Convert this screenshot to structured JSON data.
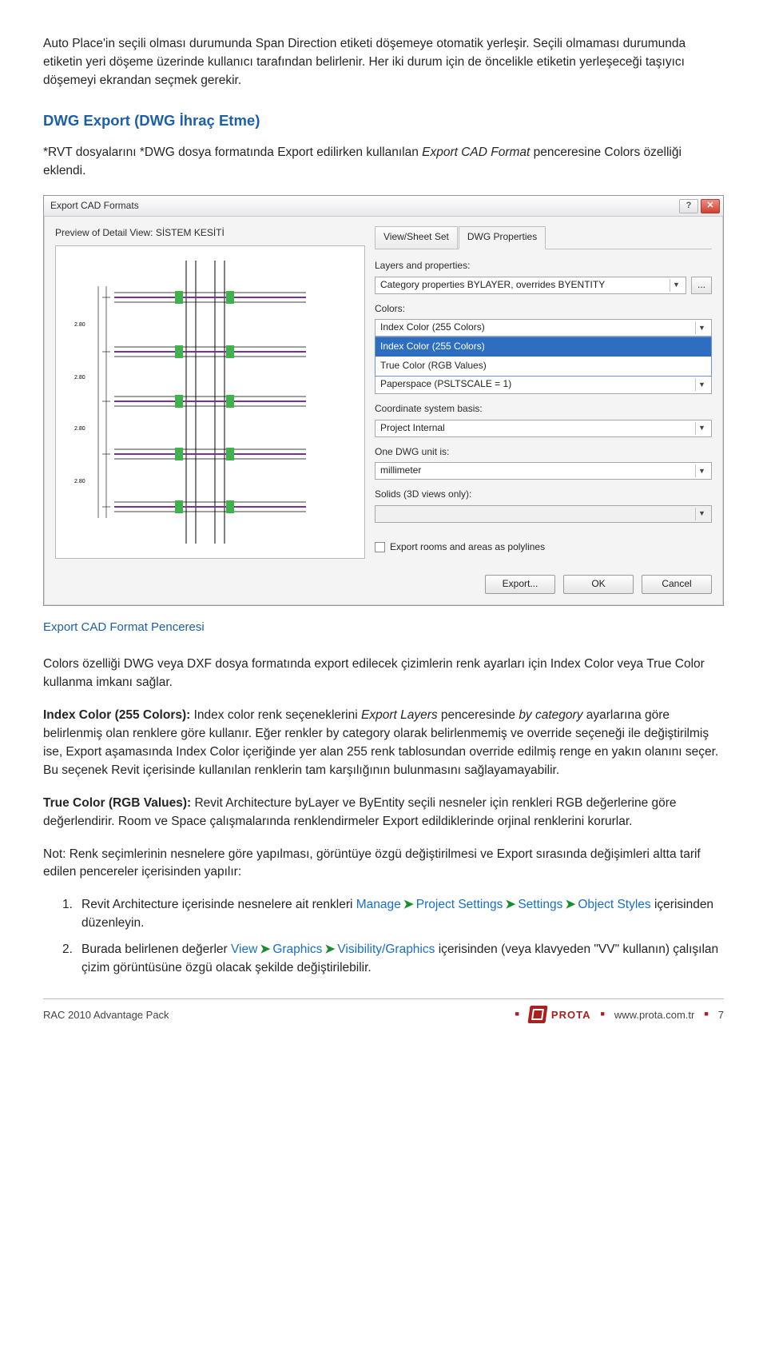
{
  "intro_para_1": "Auto Place'in seçili olması durumunda Span Direction etiketi döşemeye otomatik yerleşir. Seçili olmaması durumunda etiketin yeri döşeme üzerinde kullanıcı tarafından belirlenir. Her iki durum için de öncelikle etiketin yerleşeceği taşıyıcı döşemeyi ekrandan seçmek gerekir.",
  "heading_dwg": "DWG Export (DWG İhraç Etme)",
  "rvt_para_lead": "*RVT dosyalarını *DWG dosya formatında Export edilirken kullanılan ",
  "rvt_para_italic": "Export CAD Format",
  "rvt_para_tail": " penceresine Colors özelliği eklendi.",
  "dialog": {
    "title": "Export CAD Formats",
    "help_icon": "?",
    "close_icon": "✕",
    "preview_label": "Preview of Detail View: SİSTEM KESİTİ",
    "tabs": {
      "view": "View/Sheet Set",
      "dwg": "DWG Properties"
    },
    "fields": {
      "layers_label": "Layers and properties:",
      "layers_value": "Category properties BYLAYER, overrides BYENTITY",
      "colors_label": "Colors:",
      "colors_selected": "Index Color (255 Colors)",
      "colors_options": [
        "Index Color (255 Colors)",
        "True Color (RGB Values)"
      ],
      "linetype_label": "",
      "linetype_value": "Paperspace (PSLTSCALE = 1)",
      "coord_label": "Coordinate system basis:",
      "coord_value": "Project Internal",
      "unit_label": "One DWG unit is:",
      "unit_value": "millimeter",
      "solids_label": "Solids (3D views only):",
      "solids_value": ""
    },
    "checkbox_label": "Export rooms and areas as polylines",
    "buttons": {
      "export": "Export...",
      "ok": "OK",
      "cancel": "Cancel"
    }
  },
  "caption": "Export CAD Format Penceresi",
  "colors_para": "Colors özelliği DWG veya DXF dosya formatında export edilecek çizimlerin renk ayarları için Index Color veya True Color kullanma imkanı sağlar.",
  "index_bold": "Index Color (255 Colors): ",
  "index_seg1": "Index color renk seçeneklerini ",
  "index_italic1": "Export Layers",
  "index_seg2": " penceresinde ",
  "index_italic2": "by category",
  "index_seg3": " ayarlarına göre belirlenmiş olan renklere göre kullanır. Eğer renkler by category olarak belirlenmemiş ve override seçeneği ile değiştirilmiş ise, Export aşamasında Index Color içeriğinde yer alan 255 renk tablosundan override edilmiş renge en yakın olanını seçer. Bu seçenek Revit içerisinde kullanılan renklerin tam karşılığının bulunmasını sağlayamayabilir.",
  "true_bold": "True Color (RGB Values): ",
  "true_rest": "Revit Architecture byLayer ve ByEntity seçili nesneler için renkleri RGB değerlerine göre değerlendirir. Room ve Space çalışmalarında renklendirmeler Export edildiklerinde orjinal renklerini korurlar.",
  "note_para": "Not:  Renk seçimlerinin nesnelere göre yapılması, görüntüye özgü değiştirilmesi ve Export sırasında değişimleri altta tarif edilen pencereler içerisinden yapılır:",
  "list1_num": "1.",
  "list1_lead": "Revit Architecture içerisinde nesnelere ait renkleri ",
  "list1_l1": "Manage",
  "list1_l2": "Project Settings",
  "list1_l3": "Settings",
  "list1_l4": "Object Styles",
  "list1_tail": " içerisinden düzenleyin.",
  "list2_num": "2.",
  "list2_lead": "Burada belirlenen değerler ",
  "list2_l1": "View",
  "list2_l2": "Graphics",
  "list2_l3": "Visibility/Graphics",
  "list2_tail": " içerisinden (veya klavyeden \"VV\" kullanın) çalışılan çizim görüntüsüne özgü olacak şekilde değiştirilebilir.",
  "footer": {
    "left": "RAC 2010 Advantage Pack",
    "brand": "PROTA",
    "url": "www.prota.com.tr",
    "page": "7"
  },
  "arrow_glyph": "➤"
}
